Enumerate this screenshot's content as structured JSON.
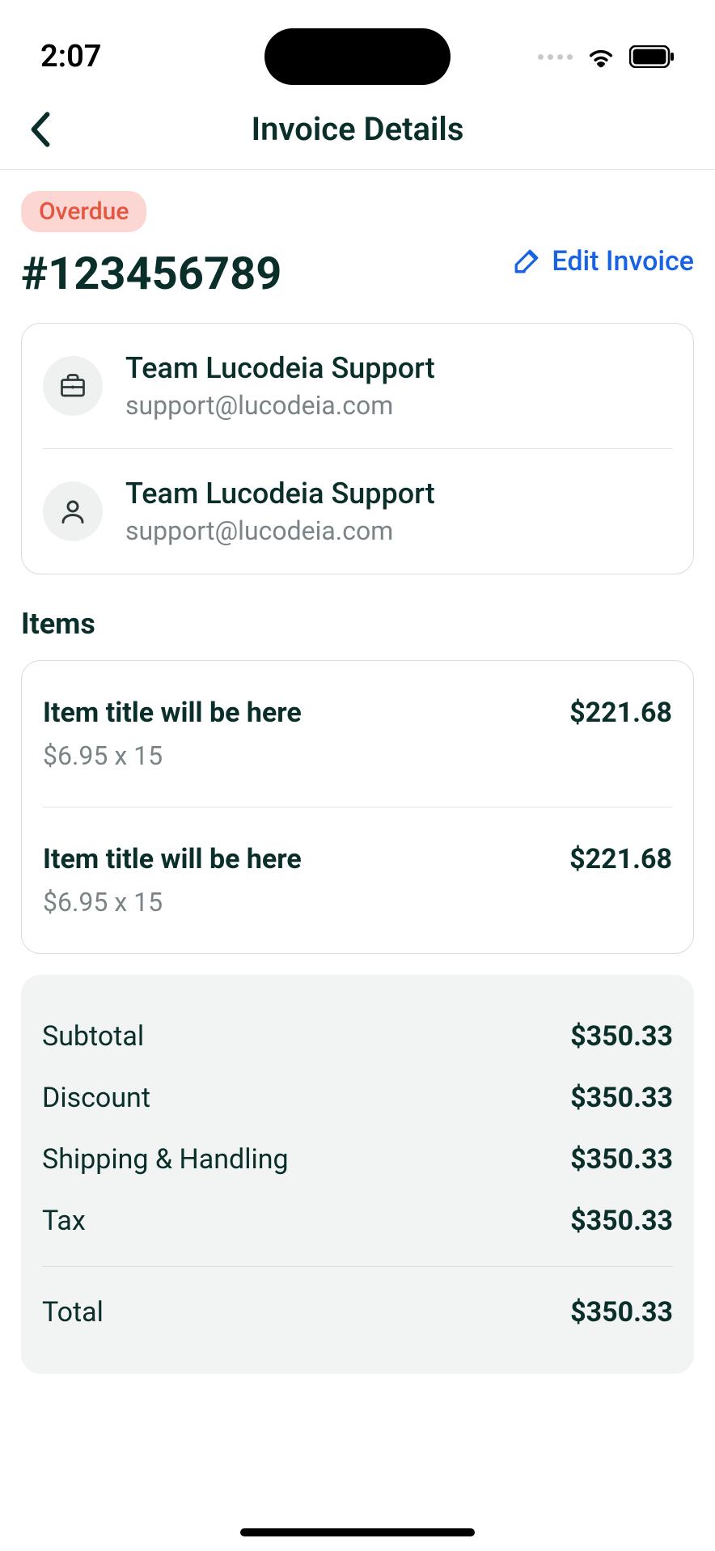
{
  "statusBar": {
    "time": "2:07"
  },
  "header": {
    "title": "Invoice Details"
  },
  "invoice": {
    "statusBadge": "Overdue",
    "number": "#123456789",
    "editLabel": "Edit Invoice"
  },
  "contacts": [
    {
      "name": "Team Lucodeia Support",
      "email": "support@lucodeia.com",
      "icon": "briefcase"
    },
    {
      "name": "Team Lucodeia Support",
      "email": "support@lucodeia.com",
      "icon": "person"
    }
  ],
  "itemsSection": {
    "title": "Items"
  },
  "items": [
    {
      "title": "Item title will be here",
      "sub": "$6.95 x 15",
      "price": "$221.68"
    },
    {
      "title": "Item title will be here",
      "sub": "$6.95 x 15",
      "price": "$221.68"
    }
  ],
  "totals": {
    "rows": [
      {
        "label": "Subtotal",
        "value": "$350.33"
      },
      {
        "label": "Discount",
        "value": "$350.33"
      },
      {
        "label": "Shipping & Handling",
        "value": "$350.33"
      },
      {
        "label": "Tax",
        "value": "$350.33"
      }
    ],
    "totalLabel": "Total",
    "totalValue": "$350.33"
  }
}
